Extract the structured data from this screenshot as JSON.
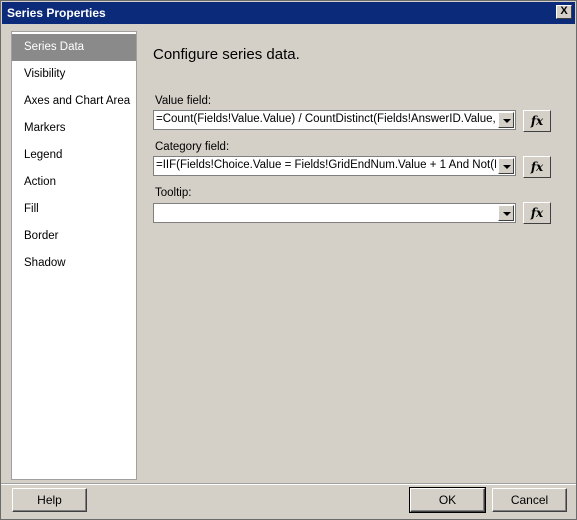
{
  "window": {
    "title": "Series Properties",
    "close_glyph": "X"
  },
  "nav": {
    "items": [
      {
        "label": "Series Data",
        "selected": true
      },
      {
        "label": "Visibility"
      },
      {
        "label": "Axes and Chart Area"
      },
      {
        "label": "Markers"
      },
      {
        "label": "Legend"
      },
      {
        "label": "Action"
      },
      {
        "label": "Fill"
      },
      {
        "label": "Border"
      },
      {
        "label": "Shadow"
      }
    ]
  },
  "main": {
    "heading": "Configure series data.",
    "value_field": {
      "label": "Value field:",
      "value": "=Count(Fields!Value.Value) / CountDistinct(Fields!AnswerID.Value,"
    },
    "category_field": {
      "label": "Category field:",
      "value": "=IIF(Fields!Choice.Value = Fields!GridEndNum.Value + 1 And Not(Is"
    },
    "tooltip": {
      "label": "Tooltip:",
      "value": ""
    },
    "fx_label": "fx"
  },
  "footer": {
    "help": "Help",
    "ok": "OK",
    "cancel": "Cancel"
  }
}
